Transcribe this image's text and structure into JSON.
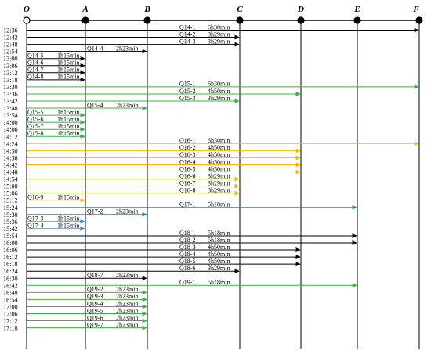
{
  "colors": {
    "black": "#000000",
    "green": "#3cb043",
    "orange": "#f5b800",
    "blue": "#2f7fc1"
  },
  "stations": [
    {
      "label": "O"
    },
    {
      "label": "A"
    },
    {
      "label": "B"
    },
    {
      "label": "C"
    },
    {
      "label": "D"
    },
    {
      "label": "E"
    },
    {
      "label": "F"
    }
  ],
  "trips": [
    {
      "time": "12:36",
      "id": "Q14-1",
      "duration": "6h30min",
      "to": 6,
      "color": "black"
    },
    {
      "time": "12:42",
      "id": "Q14-2",
      "duration": "3h29min",
      "to": 3,
      "color": "black"
    },
    {
      "time": "12:48",
      "id": "Q14-3",
      "duration": "3h29min",
      "to": 3,
      "color": "black"
    },
    {
      "time": "12:54",
      "id": "Q14-4",
      "duration": "2h23min",
      "to": 2,
      "color": "black"
    },
    {
      "time": "13:00",
      "id": "Q14-5",
      "duration": "1h15min",
      "to": 1,
      "color": "black"
    },
    {
      "time": "13:06",
      "id": "Q14-6",
      "duration": "1h15min",
      "to": 1,
      "color": "black"
    },
    {
      "time": "13:12",
      "id": "Q14-7",
      "duration": "1h15min",
      "to": 1,
      "color": "black"
    },
    {
      "time": "13:18",
      "id": "Q14-8",
      "duration": "1h15min",
      "to": 1,
      "color": "black"
    },
    {
      "time": "13:30",
      "id": "Q15-1",
      "duration": "6h30min",
      "to": 6,
      "color": "green"
    },
    {
      "time": "13:36",
      "id": "Q15-2",
      "duration": "4h50min",
      "to": 4,
      "color": "green"
    },
    {
      "time": "13:42",
      "id": "Q15-3",
      "duration": "3h29min",
      "to": 3,
      "color": "green"
    },
    {
      "time": "13:48",
      "id": "Q15-4",
      "duration": "2h23min",
      "to": 2,
      "color": "green"
    },
    {
      "time": "13:54",
      "id": "Q15-5",
      "duration": "1h15min",
      "to": 1,
      "color": "green"
    },
    {
      "time": "14:00",
      "id": "Q15-6",
      "duration": "1h15min",
      "to": 1,
      "color": "green"
    },
    {
      "time": "14:06",
      "id": "Q15-7",
      "duration": "1h15min",
      "to": 1,
      "color": "green"
    },
    {
      "time": "14:12",
      "id": "Q15-8",
      "duration": "1h15min",
      "to": 1,
      "color": "green"
    },
    {
      "time": "14:24",
      "id": "Q16-1",
      "duration": "6h30min",
      "to": 6,
      "color": "orange"
    },
    {
      "time": "14:30",
      "id": "Q16-2",
      "duration": "4h50min",
      "to": 4,
      "color": "orange"
    },
    {
      "time": "14:36",
      "id": "Q16-3",
      "duration": "4h50min",
      "to": 4,
      "color": "orange"
    },
    {
      "time": "14:42",
      "id": "Q16-4",
      "duration": "4h50min",
      "to": 4,
      "color": "orange"
    },
    {
      "time": "14:48",
      "id": "Q16-5",
      "duration": "4h50min",
      "to": 4,
      "color": "orange"
    },
    {
      "time": "14:54",
      "id": "Q16-6",
      "duration": "3h29min",
      "to": 3,
      "color": "orange"
    },
    {
      "time": "15:00",
      "id": "Q16-7",
      "duration": "3h29min",
      "to": 3,
      "color": "orange"
    },
    {
      "time": "15:06",
      "id": "Q16-8",
      "duration": "3h29min",
      "to": 3,
      "color": "orange"
    },
    {
      "time": "15:12",
      "id": "Q16-9",
      "duration": "1h15min",
      "to": 1,
      "color": "orange"
    },
    {
      "time": "15:24",
      "id": "Q17-1",
      "duration": "5h18min",
      "to": 5,
      "color": "blue"
    },
    {
      "time": "15:30",
      "id": "Q17-2",
      "duration": "2h23min",
      "to": 2,
      "color": "blue"
    },
    {
      "time": "15:36",
      "id": "Q17-3",
      "duration": "1h15min",
      "to": 1,
      "color": "blue"
    },
    {
      "time": "15:42",
      "id": "Q17-4",
      "duration": "1h15min",
      "to": 1,
      "color": "blue"
    },
    {
      "time": "15:54",
      "id": "Q18-1",
      "duration": "5h18min",
      "to": 5,
      "color": "black"
    },
    {
      "time": "16:00",
      "id": "Q18-2",
      "duration": "5h18min",
      "to": 5,
      "color": "black"
    },
    {
      "time": "16:06",
      "id": "Q18-3",
      "duration": "4h50min",
      "to": 4,
      "color": "black"
    },
    {
      "time": "16:12",
      "id": "Q18-4",
      "duration": "4h50min",
      "to": 4,
      "color": "black"
    },
    {
      "time": "16:18",
      "id": "Q18-5",
      "duration": "4h50min",
      "to": 4,
      "color": "black"
    },
    {
      "time": "16:24",
      "id": "Q18-6",
      "duration": "3h29min",
      "to": 3,
      "color": "black"
    },
    {
      "time": "16:30",
      "id": "Q18-7",
      "duration": "2h23min",
      "to": 2,
      "color": "black"
    },
    {
      "time": "16:42",
      "id": "Q19-1",
      "duration": "5h18min",
      "to": 5,
      "color": "green"
    },
    {
      "time": "16:48",
      "id": "Q19-2",
      "duration": "2h23min",
      "to": 2,
      "color": "green"
    },
    {
      "time": "16:54",
      "id": "Q19-3",
      "duration": "2h23min",
      "to": 2,
      "color": "green"
    },
    {
      "time": "17:00",
      "id": "Q19-4",
      "duration": "2h23min",
      "to": 2,
      "color": "green"
    },
    {
      "time": "17:06",
      "id": "Q19-5",
      "duration": "2h23min",
      "to": 2,
      "color": "green"
    },
    {
      "time": "17:12",
      "id": "Q19-6",
      "duration": "2h23min",
      "to": 2,
      "color": "green"
    },
    {
      "time": "17:18",
      "id": "Q19-7",
      "duration": "2h23min",
      "to": 2,
      "color": "green"
    }
  ]
}
